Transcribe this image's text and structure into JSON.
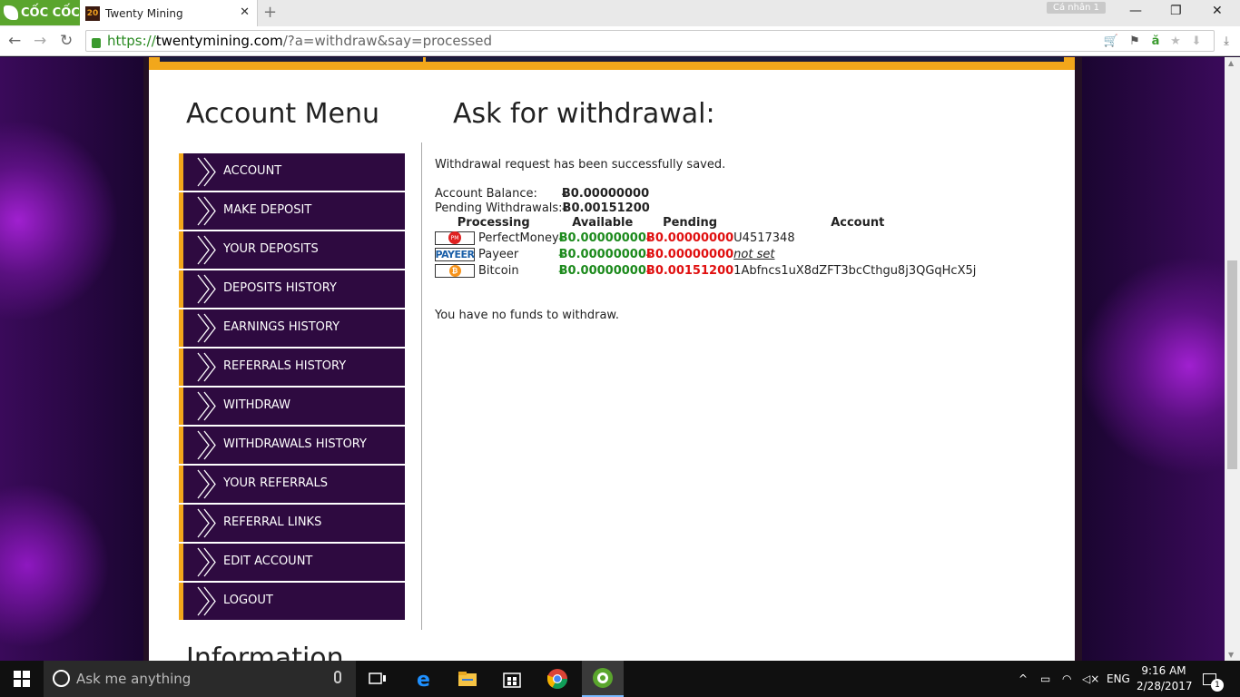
{
  "browser": {
    "brand": "CỐC CỐC",
    "tab_title": "Twenty Mining",
    "tab_icon_text": "20",
    "profile": "Cá nhân 1",
    "url_prefix": "https://",
    "url_domain": "twentymining.com",
    "url_path": "/?a=withdraw&say=processed"
  },
  "sidebar": {
    "title": "Account Menu",
    "items": [
      {
        "label": "ACCOUNT"
      },
      {
        "label": "MAKE DEPOSIT"
      },
      {
        "label": "YOUR DEPOSITS"
      },
      {
        "label": "DEPOSITS HISTORY"
      },
      {
        "label": "EARNINGS HISTORY"
      },
      {
        "label": "REFERRALS HISTORY"
      },
      {
        "label": "WITHDRAW"
      },
      {
        "label": "WITHDRAWALS HISTORY"
      },
      {
        "label": "YOUR REFERRALS"
      },
      {
        "label": "REFERRAL LINKS"
      },
      {
        "label": "EDIT ACCOUNT"
      },
      {
        "label": "LOGOUT"
      }
    ],
    "info_title": "Information"
  },
  "main": {
    "title": "Ask for withdrawal:",
    "message": "Withdrawal request has been successfully saved.",
    "account_balance_label": "Account Balance:",
    "account_balance_value": "Ƀ0.00000000",
    "pending_label": "Pending Withdrawals:",
    "pending_value": "Ƀ0.00151200",
    "table": {
      "headers": [
        "Processing",
        "Available",
        "Pending",
        "Account"
      ],
      "rows": [
        {
          "icon": "PM",
          "name": "PerfectMoney",
          "available": "Ƀ0.00000000",
          "pending": "Ƀ0.00000000",
          "account": "U4517348"
        },
        {
          "icon": "PAYEER",
          "name": "Payeer",
          "available": "Ƀ0.00000000",
          "pending": "Ƀ0.00000000",
          "account": "not set"
        },
        {
          "icon": "₿",
          "name": "Bitcoin",
          "available": "Ƀ0.00000000",
          "pending": "Ƀ0.00151200",
          "account": "1Abfncs1uX8dZFT3bcCthgu8j3QGqHcX5j"
        }
      ]
    },
    "no_funds": "You have no funds to withdraw."
  },
  "taskbar": {
    "search_placeholder": "Ask me anything",
    "lang": "ENG",
    "time": "9:16 AM",
    "date": "2/28/2017",
    "notifications": "1"
  }
}
